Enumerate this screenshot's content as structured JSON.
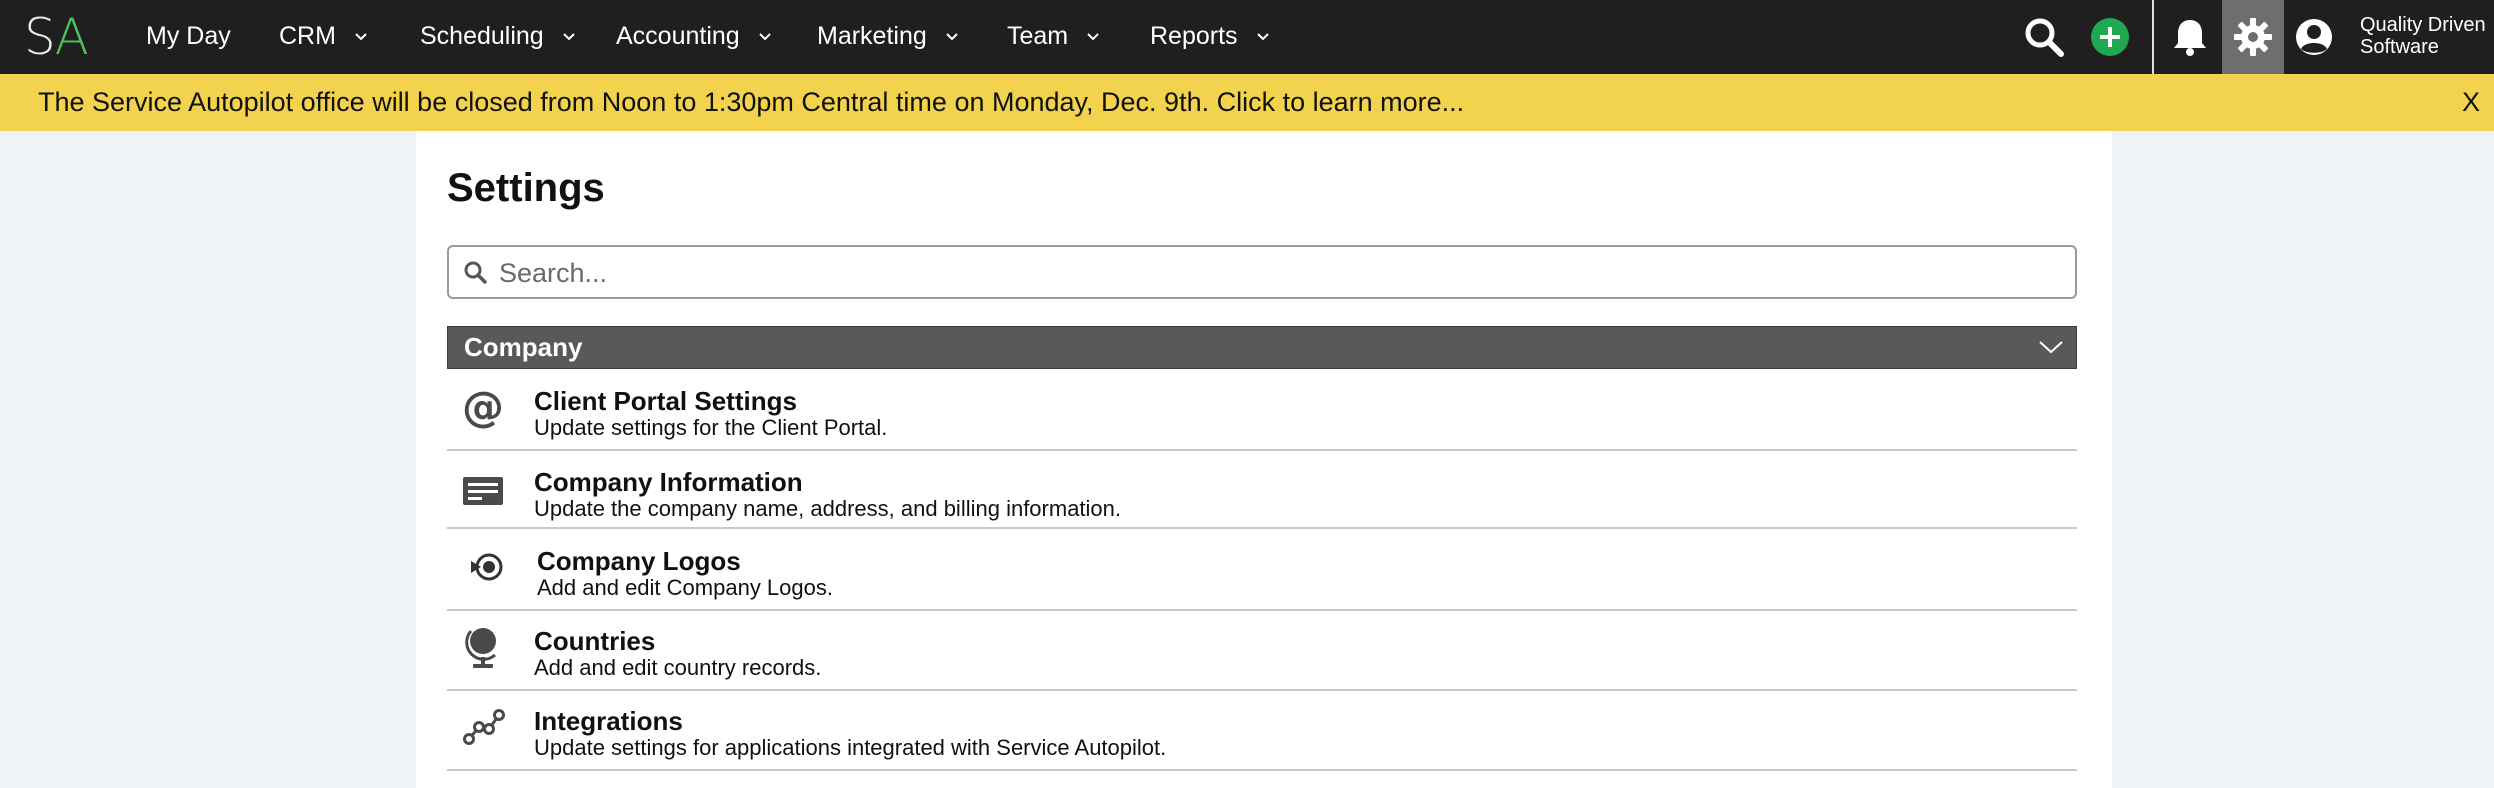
{
  "app": {
    "logo_s": "S",
    "logo_a": "A",
    "brand_green": "#4cc15c"
  },
  "nav": {
    "items": [
      {
        "label": "My Day"
      },
      {
        "label": "CRM"
      },
      {
        "label": "Scheduling"
      },
      {
        "label": "Accounting"
      },
      {
        "label": "Marketing"
      },
      {
        "label": "Team"
      },
      {
        "label": "Reports"
      }
    ],
    "icons": [
      "search-icon",
      "add-icon",
      "bell-icon",
      "gear-icon",
      "user-icon"
    ],
    "user_name_line1": "Quality Driven",
    "user_name_line2": "Software"
  },
  "banner": {
    "text": "The Service Autopilot office will be closed from Noon to 1:30pm Central time on Monday, Dec. 9th. Click to learn more...",
    "close": "X",
    "color": "#f3d34e"
  },
  "page": {
    "title": "Settings",
    "search_placeholder": "Search..."
  },
  "section": {
    "title": "Company",
    "items": [
      {
        "title": "Client Portal Settings",
        "desc": "Update settings for the Client Portal.",
        "icon": "at-sign-icon"
      },
      {
        "title": "Company Information",
        "desc": "Update the company name, address, and billing information.",
        "icon": "card-icon"
      },
      {
        "title": "Company Logos",
        "desc": "Add and edit Company Logos.",
        "icon": "logo-target-icon"
      },
      {
        "title": "Countries",
        "desc": "Add and edit country records.",
        "icon": "globe-icon"
      },
      {
        "title": "Integrations",
        "desc": "Update settings for applications integrated with Service Autopilot.",
        "icon": "integrations-icon"
      }
    ]
  }
}
